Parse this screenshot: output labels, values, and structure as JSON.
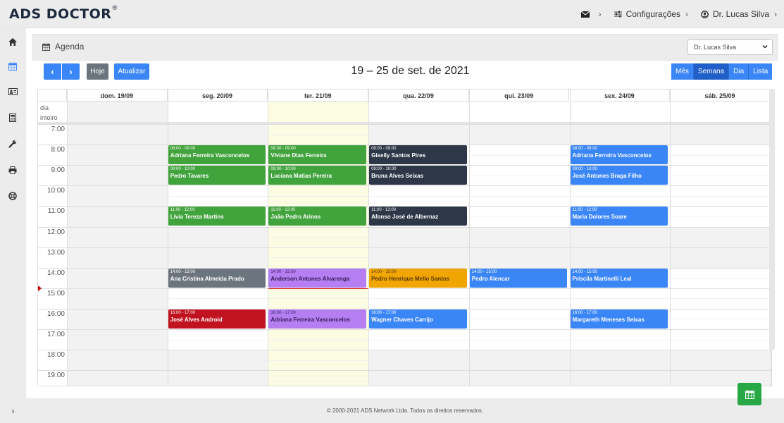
{
  "app": {
    "logo": "ADS DOCTOR",
    "logo_mark": "®"
  },
  "topnav": {
    "config_label": "Configurações",
    "user_name": "Dr. Lucas Silva",
    "chevron": "›"
  },
  "sidebar": {
    "expand_label": "›"
  },
  "panel": {
    "title": "Agenda",
    "doctor_select": "Dr. Lucas Silva"
  },
  "toolbar": {
    "prev": "‹",
    "next": "›",
    "today": "Hoje",
    "refresh": "Atualizar",
    "title": "19 – 25 de set. de 2021"
  },
  "views": {
    "month": "Mês",
    "week": "Semana",
    "day": "Dia",
    "list": "Lista"
  },
  "calendar": {
    "allday_label": "dia inteiro",
    "days": [
      "dom. 19/09",
      "seg. 20/09",
      "ter. 21/09",
      "qua. 22/09",
      "qui. 23/09",
      "sex. 24/09",
      "sáb. 25/09"
    ],
    "hours": [
      "7:00",
      "8:00",
      "9:00",
      "10:00",
      "11:00",
      "12:00",
      "13:00",
      "14:00",
      "15:00",
      "16:00",
      "17:00",
      "18:00",
      "19:00"
    ],
    "today_index": 2,
    "now_hour": 15,
    "events": [
      {
        "day": 1,
        "start": 8,
        "end": 9,
        "time": "08:00 - 09:00",
        "name": "Adriana Ferreira Vasconcelos",
        "bg": "#41a33b",
        "fg": "#ffffff"
      },
      {
        "day": 1,
        "start": 9,
        "end": 10,
        "time": "09:00 - 10:00",
        "name": "Pedro Tavares",
        "bg": "#41a33b",
        "fg": "#ffffff"
      },
      {
        "day": 1,
        "start": 11,
        "end": 12,
        "time": "11:00 - 12:00",
        "name": "Lívia Tereza Martins",
        "bg": "#41a33b",
        "fg": "#ffffff"
      },
      {
        "day": 1,
        "start": 14,
        "end": 15,
        "time": "14:00 - 15:00",
        "name": "Ana Cristina Almeida Prado",
        "bg": "#6c757d",
        "fg": "#ffffff"
      },
      {
        "day": 1,
        "start": 16,
        "end": 17,
        "time": "16:00 - 17:00",
        "name": "José Alves Android",
        "bg": "#c1121f",
        "fg": "#ffffff"
      },
      {
        "day": 2,
        "start": 8,
        "end": 9,
        "time": "08:00 - 09:00",
        "name": "Viviane Dias Ferreira",
        "bg": "#41a33b",
        "fg": "#ffffff"
      },
      {
        "day": 2,
        "start": 9,
        "end": 10,
        "time": "09:00 - 10:00",
        "name": "Luciana Matias Pereira",
        "bg": "#41a33b",
        "fg": "#ffffff"
      },
      {
        "day": 2,
        "start": 11,
        "end": 12,
        "time": "11:00 - 12:00",
        "name": "João Pedro Arinos",
        "bg": "#41a33b",
        "fg": "#ffffff"
      },
      {
        "day": 2,
        "start": 14,
        "end": 15,
        "time": "14:00 - 15:00",
        "name": "Anderson Antunes Alvarenga",
        "bg": "#b57ff2",
        "fg": "#3a1c5e"
      },
      {
        "day": 2,
        "start": 16,
        "end": 17,
        "time": "16:00 - 17:00",
        "name": "Adriana Ferreira Vasconcelos",
        "bg": "#b57ff2",
        "fg": "#3a1c5e"
      },
      {
        "day": 3,
        "start": 8,
        "end": 9,
        "time": "08:00 - 09:00",
        "name": "Giselly Santos Pires",
        "bg": "#2d3748",
        "fg": "#ffffff"
      },
      {
        "day": 3,
        "start": 9,
        "end": 10,
        "time": "09:00 - 10:00",
        "name": "Bruna Alves Seixas",
        "bg": "#2d3748",
        "fg": "#ffffff"
      },
      {
        "day": 3,
        "start": 11,
        "end": 12,
        "time": "11:00 - 12:00",
        "name": "Afonso José de Albernaz",
        "bg": "#2d3748",
        "fg": "#ffffff"
      },
      {
        "day": 3,
        "start": 14,
        "end": 15,
        "time": "14:00 - 15:00",
        "name": "Pedro Henrique Mello Santos",
        "bg": "#f0a500",
        "fg": "#5a3a00"
      },
      {
        "day": 3,
        "start": 16,
        "end": 17,
        "time": "16:00 - 17:00",
        "name": "Wagner Chaves Carrijo",
        "bg": "#3a86f7",
        "fg": "#ffffff"
      },
      {
        "day": 4,
        "start": 14,
        "end": 15,
        "time": "14:00 - 15:00",
        "name": "Pedro Alencar",
        "bg": "#3a86f7",
        "fg": "#ffffff"
      },
      {
        "day": 5,
        "start": 8,
        "end": 9,
        "time": "08:00 - 09:00",
        "name": "Adriana Ferreira Vasconcelos",
        "bg": "#3a86f7",
        "fg": "#ffffff"
      },
      {
        "day": 5,
        "start": 9,
        "end": 10,
        "time": "09:00 - 10:00",
        "name": "José Antunes Braga Filho",
        "bg": "#3a86f7",
        "fg": "#ffffff"
      },
      {
        "day": 5,
        "start": 11,
        "end": 12,
        "time": "11:00 - 12:00",
        "name": "Maria Dolores Soare",
        "bg": "#3a86f7",
        "fg": "#ffffff"
      },
      {
        "day": 5,
        "start": 14,
        "end": 15,
        "time": "14:00 - 15:00",
        "name": "Priscila Martinelli Leal",
        "bg": "#3a86f7",
        "fg": "#ffffff"
      },
      {
        "day": 5,
        "start": 16,
        "end": 17,
        "time": "16:00 - 17:00",
        "name": "Margareth Meneses Seixas",
        "bg": "#3a86f7",
        "fg": "#ffffff"
      }
    ]
  },
  "footer": {
    "copyright": "© 2000-2021 ADS Network Ltda. Todos os direitos reservados."
  },
  "colors": {
    "primary": "#3a86f7",
    "today_bg": "#fcfce3",
    "business_off": "#f2f2f2",
    "fab": "#28a745"
  }
}
